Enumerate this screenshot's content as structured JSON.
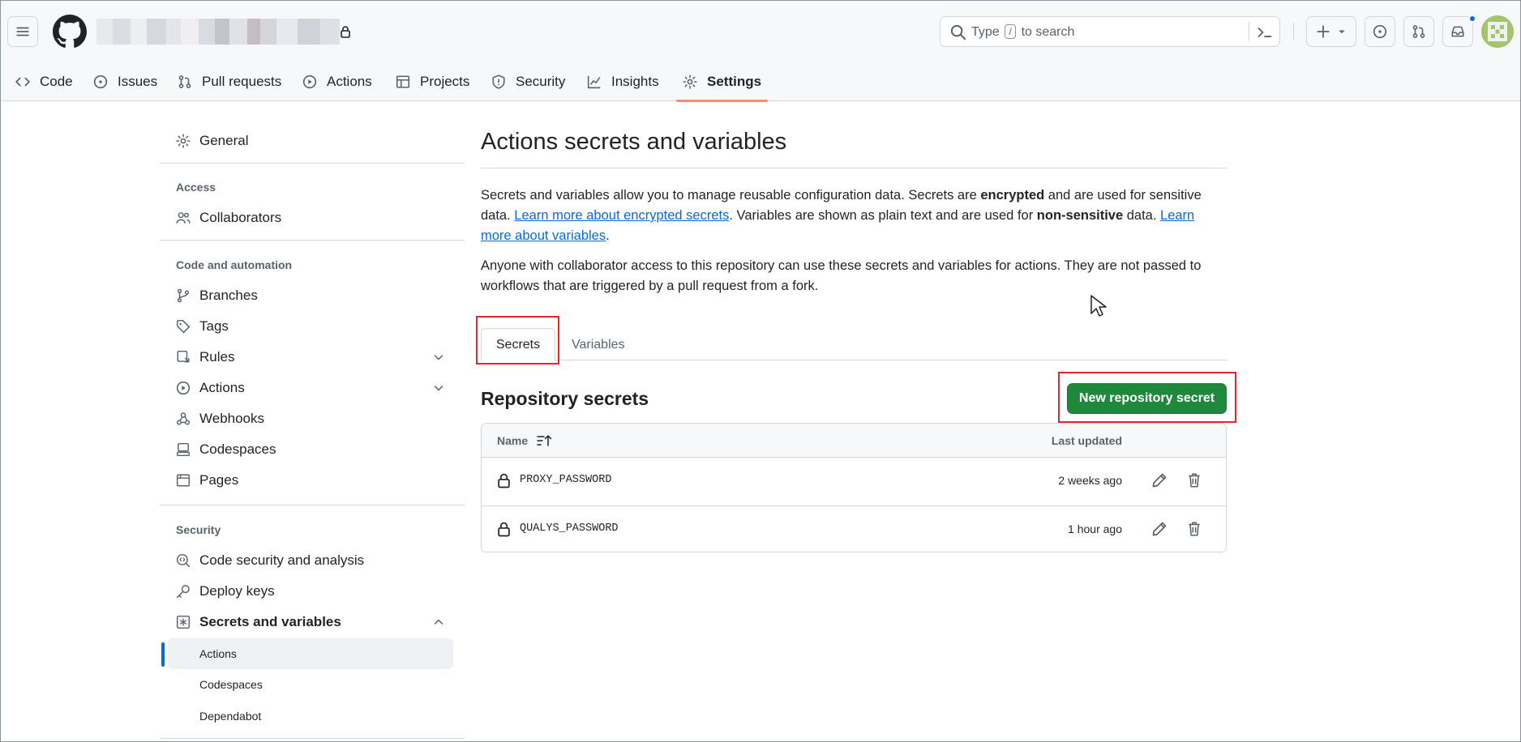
{
  "colors": {
    "accent": "#0969da",
    "primary_button": "#1f883d",
    "selected_tab_underline": "#fd8c73",
    "highlight_box": "#e5262a"
  },
  "header": {
    "search_placeholder_prefix": "Type",
    "search_key": "/",
    "search_placeholder_suffix": "to search"
  },
  "repo_nav": {
    "tabs": [
      {
        "label": "Code",
        "icon": "code-icon"
      },
      {
        "label": "Issues",
        "icon": "issue-icon"
      },
      {
        "label": "Pull requests",
        "icon": "pull-request-icon"
      },
      {
        "label": "Actions",
        "icon": "play-icon"
      },
      {
        "label": "Projects",
        "icon": "table-icon"
      },
      {
        "label": "Security",
        "icon": "shield-icon"
      },
      {
        "label": "Insights",
        "icon": "graph-icon"
      },
      {
        "label": "Settings",
        "icon": "gear-icon"
      }
    ],
    "selected": "Settings"
  },
  "sidebar": {
    "general": "General",
    "access_heading": "Access",
    "collaborators": "Collaborators",
    "code_heading": "Code and automation",
    "branches": "Branches",
    "tags": "Tags",
    "rules": "Rules",
    "actions": "Actions",
    "webhooks": "Webhooks",
    "codespaces": "Codespaces",
    "pages": "Pages",
    "security_heading": "Security",
    "code_security": "Code security and analysis",
    "deploy_keys": "Deploy keys",
    "secrets_and_variables": "Secrets and variables",
    "sub_actions": "Actions",
    "sub_codespaces": "Codespaces",
    "sub_dependabot": "Dependabot"
  },
  "main": {
    "title": "Actions secrets and variables",
    "p1_a": "Secrets and variables allow you to manage reusable configuration data. Secrets are ",
    "p1_b": "encrypted",
    "p1_c": " and are used for sensitive data. ",
    "p1_link1": "Learn more about encrypted secrets",
    "p1_d": ". Variables are shown as plain text and are used for ",
    "p1_e": "non-sensitive",
    "p1_f": " data. ",
    "p1_link2": "Learn more about variables",
    "p1_g": ".",
    "p2": "Anyone with collaborator access to this repository can use these secrets and variables for actions. They are not passed to workflows that are triggered by a pull request from a fork.",
    "tab_secrets": "Secrets",
    "tab_variables": "Variables",
    "section_title": "Repository secrets",
    "new_button": "New repository secret",
    "col_name": "Name",
    "col_updated": "Last updated",
    "secrets": [
      {
        "name": "PROXY_PASSWORD",
        "updated": "2 weeks ago"
      },
      {
        "name": "QUALYS_PASSWORD",
        "updated": "1 hour ago"
      }
    ]
  }
}
